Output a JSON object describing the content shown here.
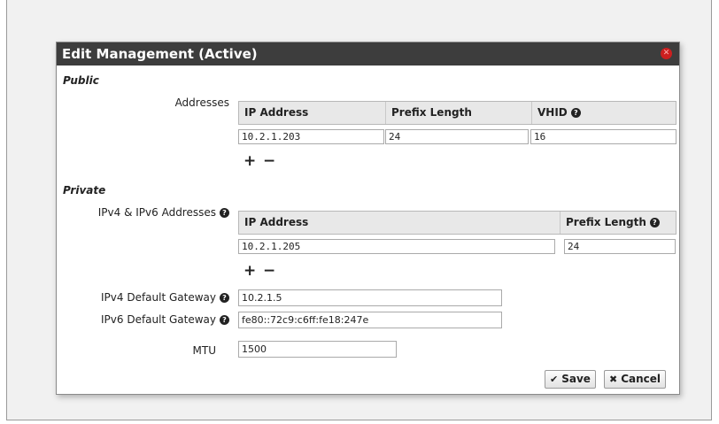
{
  "dialog": {
    "title": "Edit Management (Active)",
    "close_glyph": "✕"
  },
  "public": {
    "title": "Public",
    "addresses_label": "Addresses",
    "columns": [
      "IP Address",
      "Prefix Length",
      "VHID"
    ],
    "rows": [
      {
        "ip": "10.2.1.203",
        "prefix": "24",
        "vhid": "16"
      }
    ]
  },
  "private": {
    "title": "Private",
    "addresses_label": "IPv4 & IPv6 Addresses",
    "columns": [
      "IP Address",
      "Prefix Length"
    ],
    "rows": [
      {
        "ip": "10.2.1.205",
        "prefix": "24"
      }
    ]
  },
  "fields": {
    "ipv4_gateway_label": "IPv4 Default Gateway",
    "ipv4_gateway_value": "10.2.1.5",
    "ipv6_gateway_label": "IPv6 Default Gateway",
    "ipv6_gateway_value": "fe80::72c9:c6ff:fe18:247e",
    "mtu_label": "MTU",
    "mtu_value": "1500"
  },
  "buttons": {
    "add": "+",
    "remove": "−",
    "save": "Save",
    "cancel": "Cancel"
  },
  "icons": {
    "help": "?",
    "save": "✔",
    "cancel": "✖"
  },
  "colors": {
    "titlebar": "#3d3d3d",
    "close": "#cc1f1f",
    "header_bg": "#e8e8e8"
  }
}
